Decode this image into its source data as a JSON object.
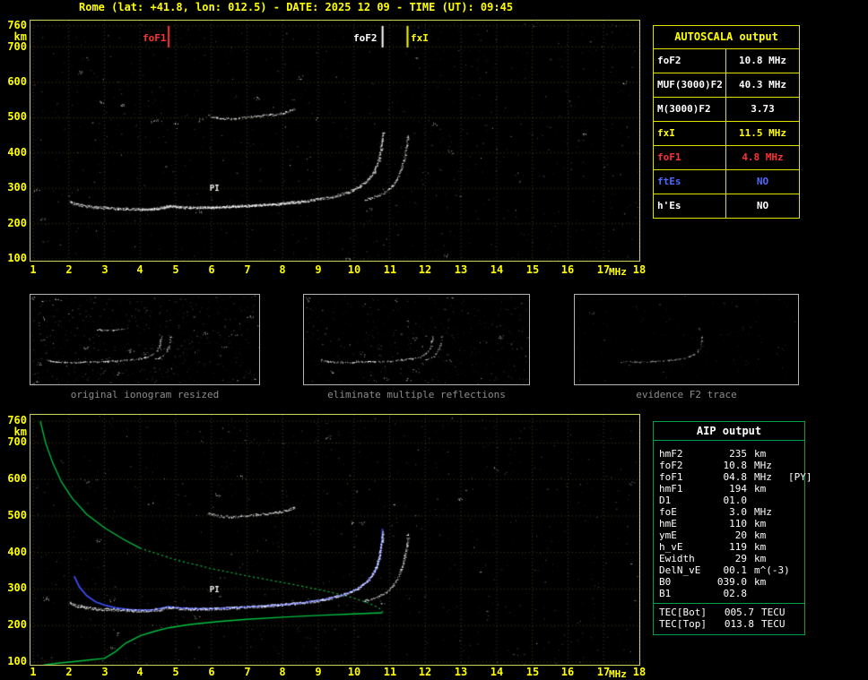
{
  "header": {
    "title": "Rome (lat: +41.8, lon: 012.5) - DATE: 2025 12 09 - TIME (UT): 09:45"
  },
  "colors": {
    "yellow": "#ffff00",
    "red": "#ff3232",
    "blue": "#3a4aee",
    "white": "#ffffff",
    "green": "#00c040",
    "gray": "#8c8c8c",
    "plot_border": "#d0d060",
    "thumb_border": "#b4b4b4",
    "autoscala_border": "#e0e000",
    "aip_border": "#00a048"
  },
  "autoscala_table": {
    "title": "AUTOSCALA output",
    "rows": [
      {
        "label": "foF2",
        "value": "10.8 MHz",
        "color": "white"
      },
      {
        "label": "MUF(3000)F2",
        "value": "40.3 MHz",
        "color": "white"
      },
      {
        "label": "M(3000)F2",
        "value": "3.73",
        "color": "white"
      },
      {
        "label": "fxI",
        "value": "11.5 MHz",
        "color": "yellow"
      },
      {
        "label": "foF1",
        "value": "4.8 MHz",
        "color": "red"
      },
      {
        "label": "ftEs",
        "value": "NO",
        "color": "blue"
      },
      {
        "label": "h'Es",
        "value": "NO",
        "color": "white"
      }
    ]
  },
  "thumbnails": [
    {
      "caption": "original ionogram resized"
    },
    {
      "caption": "eliminate multiple reflections"
    },
    {
      "caption": "evidence F2 trace"
    }
  ],
  "aip_table": {
    "title": "AIP output",
    "rows": [
      {
        "label": "hmF2",
        "value": "235",
        "unit": "km",
        "note": ""
      },
      {
        "label": "foF2",
        "value": "10.8",
        "unit": "MHz",
        "note": ""
      },
      {
        "label": "foF1",
        "value": "04.8",
        "unit": "MHz",
        "note": "[PY]"
      },
      {
        "label": "hmF1",
        "value": "194",
        "unit": "km",
        "note": ""
      },
      {
        "label": "D1",
        "value": "01.0",
        "unit": "",
        "note": ""
      },
      {
        "label": "foE",
        "value": "3.0",
        "unit": "MHz",
        "note": ""
      },
      {
        "label": "hmE",
        "value": "110",
        "unit": "km",
        "note": ""
      },
      {
        "label": "ymE",
        "value": "20",
        "unit": "km",
        "note": ""
      },
      {
        "label": "h_vE",
        "value": "119",
        "unit": "km",
        "note": ""
      },
      {
        "label": "Ewidth",
        "value": "29",
        "unit": "km",
        "note": ""
      },
      {
        "label": "DelN_vE",
        "value": "00.1",
        "unit": "m^(-3)",
        "note": ""
      },
      {
        "label": "B0",
        "value": "039.0",
        "unit": "km",
        "note": ""
      },
      {
        "label": "B1",
        "value": "02.8",
        "unit": "",
        "note": ""
      }
    ],
    "tec_rows": [
      {
        "label": "TEC[Bot]",
        "value": "005.7",
        "unit": "TECU"
      },
      {
        "label": "TEC[Top]",
        "value": "013.8",
        "unit": "TECU"
      }
    ]
  },
  "chart_data": [
    {
      "id": "main_ionogram",
      "type": "scatter",
      "title": "Ionogram with autoscaled characteristics",
      "xlabel": "MHz",
      "ylabel": "km",
      "xlim": [
        1,
        18
      ],
      "ylim": [
        100,
        760
      ],
      "x_ticks": [
        1,
        2,
        3,
        4,
        5,
        6,
        7,
        8,
        9,
        10,
        11,
        12,
        13,
        14,
        15,
        16,
        17,
        18
      ],
      "y_ticks": [
        760,
        700,
        600,
        500,
        400,
        300,
        200,
        100
      ],
      "grid": true,
      "markers": [
        {
          "label": "foF1",
          "x": 4.8,
          "color": "#ff3232"
        },
        {
          "label": "foF2",
          "x": 10.8,
          "color": "#ffffff"
        },
        {
          "label": "fxI",
          "x": 11.5,
          "color": "#ffff00"
        }
      ],
      "annotations": [
        {
          "text": "PI",
          "x": 5.95,
          "y": 292
        }
      ],
      "series": [
        {
          "name": "o_trace",
          "style": "speckle",
          "color": "#ffffff",
          "points": [
            [
              2.0,
              262
            ],
            [
              2.2,
              255
            ],
            [
              2.5,
              249
            ],
            [
              2.8,
              246
            ],
            [
              3.2,
              244
            ],
            [
              3.6,
              242
            ],
            [
              4.0,
              241
            ],
            [
              4.3,
              242
            ],
            [
              4.6,
              245
            ],
            [
              4.8,
              251
            ],
            [
              5.0,
              248
            ],
            [
              5.4,
              246
            ],
            [
              5.8,
              246
            ],
            [
              6.2,
              247
            ],
            [
              6.6,
              249
            ],
            [
              7.0,
              251
            ],
            [
              7.4,
              253
            ],
            [
              7.8,
              256
            ],
            [
              8.2,
              260
            ],
            [
              8.6,
              264
            ],
            [
              9.0,
              269
            ],
            [
              9.4,
              277
            ],
            [
              9.8,
              289
            ],
            [
              10.1,
              303
            ],
            [
              10.35,
              322
            ],
            [
              10.55,
              348
            ],
            [
              10.68,
              382
            ],
            [
              10.76,
              425
            ],
            [
              10.8,
              460
            ]
          ]
        },
        {
          "name": "x_trace",
          "style": "speckle",
          "color": "#ffffff",
          "points": [
            [
              10.3,
              268
            ],
            [
              10.6,
              278
            ],
            [
              10.9,
              292
            ],
            [
              11.1,
              312
            ],
            [
              11.25,
              340
            ],
            [
              11.38,
              376
            ],
            [
              11.46,
              418
            ],
            [
              11.5,
              455
            ]
          ]
        },
        {
          "name": "second_hop",
          "style": "speckle",
          "color": "#ffffff",
          "points": [
            [
              5.9,
              506
            ],
            [
              6.2,
              500
            ],
            [
              6.6,
              498
            ],
            [
              7.0,
              502
            ],
            [
              7.4,
              506
            ],
            [
              7.8,
              510
            ],
            [
              8.1,
              516
            ],
            [
              8.35,
              526
            ]
          ]
        }
      ]
    },
    {
      "id": "profile_ionogram",
      "type": "scatter",
      "title": "Ionogram with restored electron density profile",
      "xlabel": "MHz",
      "ylabel": "km",
      "xlim": [
        1,
        18
      ],
      "ylim": [
        100,
        760
      ],
      "x_ticks": [
        1,
        2,
        3,
        4,
        5,
        6,
        7,
        8,
        9,
        10,
        11,
        12,
        13,
        14,
        15,
        16,
        17,
        18
      ],
      "y_ticks": [
        760,
        700,
        600,
        500,
        400,
        300,
        200,
        100
      ],
      "grid": true,
      "annotations": [
        {
          "text": "PI",
          "x": 5.95,
          "y": 292
        }
      ],
      "echo_series_ref": "main_ionogram",
      "series": [
        {
          "name": "topside_profile",
          "style": "line",
          "color": "#00c040",
          "points": [
            [
              1.2,
              760
            ],
            [
              1.35,
              700
            ],
            [
              1.55,
              645
            ],
            [
              1.8,
              592
            ],
            [
              2.1,
              548
            ],
            [
              2.5,
              505
            ],
            [
              3.0,
              468
            ],
            [
              3.5,
              438
            ],
            [
              4.0,
              412
            ]
          ]
        },
        {
          "name": "topside_extrapolated",
          "style": "dashed-line",
          "color": "#00c040",
          "points": [
            [
              4.0,
              412
            ],
            [
              5.0,
              380
            ],
            [
              6.0,
              356
            ],
            [
              7.0,
              336
            ],
            [
              8.0,
              318
            ],
            [
              9.0,
              299
            ],
            [
              9.8,
              281
            ],
            [
              10.4,
              262
            ],
            [
              10.7,
              248
            ],
            [
              10.8,
              237
            ]
          ]
        },
        {
          "name": "bottomside_profile",
          "style": "line",
          "color": "#00c040",
          "points": [
            [
              1.3,
              92
            ],
            [
              1.7,
              97
            ],
            [
              2.2,
              102
            ],
            [
              2.6,
              106
            ],
            [
              3.0,
              110
            ],
            [
              3.3,
              128
            ],
            [
              3.6,
              152
            ],
            [
              4.0,
              172
            ],
            [
              4.4,
              184
            ],
            [
              4.8,
              194
            ],
            [
              5.4,
              203
            ],
            [
              6.2,
              211
            ],
            [
              7.0,
              217
            ],
            [
              8.0,
              223
            ],
            [
              9.0,
              228
            ],
            [
              10.0,
              232
            ],
            [
              10.8,
              235
            ]
          ]
        },
        {
          "name": "model_trace",
          "style": "line",
          "color": "#3a4aee",
          "points": [
            [
              2.15,
              335
            ],
            [
              2.3,
              305
            ],
            [
              2.5,
              282
            ],
            [
              2.75,
              265
            ],
            [
              3.0,
              256
            ],
            [
              3.3,
              249
            ],
            [
              3.7,
              244
            ],
            [
              4.0,
              242
            ],
            [
              4.4,
              243
            ],
            [
              4.8,
              252
            ],
            [
              5.1,
              248
            ],
            [
              5.6,
              246
            ],
            [
              6.2,
              247
            ],
            [
              6.8,
              250
            ],
            [
              7.4,
              253
            ],
            [
              8.0,
              257
            ],
            [
              8.6,
              263
            ],
            [
              9.2,
              272
            ],
            [
              9.7,
              284
            ],
            [
              10.1,
              300
            ],
            [
              10.4,
              322
            ],
            [
              10.6,
              350
            ],
            [
              10.72,
              385
            ],
            [
              10.78,
              430
            ],
            [
              10.8,
              465
            ]
          ]
        }
      ]
    }
  ]
}
